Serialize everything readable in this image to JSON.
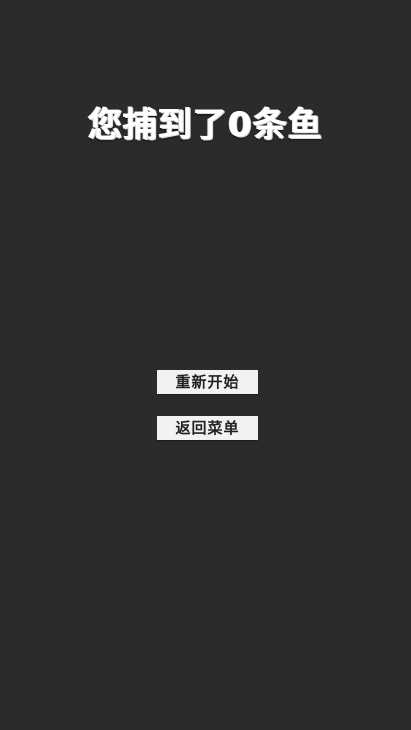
{
  "game_over": {
    "title": "您捕到了0条鱼"
  },
  "buttons": {
    "restart_label": "重新开始",
    "back_to_menu_label": "返回菜单"
  },
  "colors": {
    "background": "#2b2b2b",
    "title_text": "#ffffff",
    "button_bg": "#f2f2f2",
    "button_text": "#222222"
  }
}
